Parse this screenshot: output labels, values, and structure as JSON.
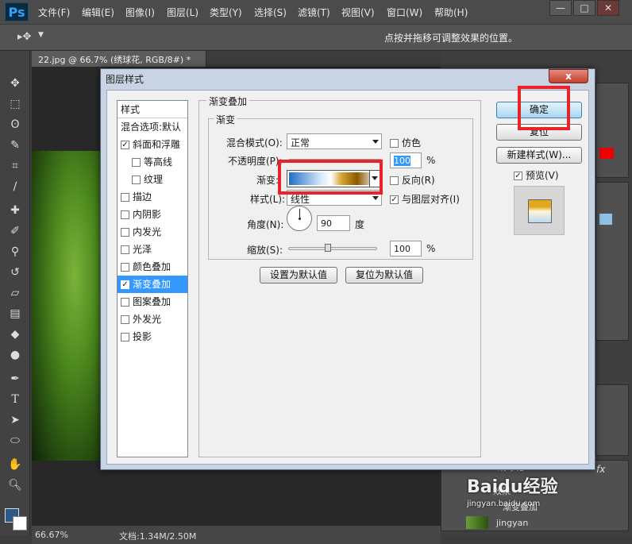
{
  "app": {
    "logo": "Ps"
  },
  "menu": [
    "文件(F)",
    "编辑(E)",
    "图像(I)",
    "图层(L)",
    "类型(Y)",
    "选择(S)",
    "滤镜(T)",
    "视图(V)",
    "窗口(W)",
    "帮助(H)"
  ],
  "window_controls": {
    "minimize": "—",
    "maximize": "□",
    "close": "✕"
  },
  "options_bar": {
    "hint": "点按并拖移可调整效果的位置。",
    "tool_glyph": "▸✥"
  },
  "document_tab": {
    "title": "22.jpg @ 66.7% (绣球花, RGB/8#) *",
    "close": "×"
  },
  "status": {
    "zoom": "66.67%",
    "doc_info": "文档:1.34M/2.50M"
  },
  "dialog": {
    "title": "图层样式",
    "close": "x",
    "styles_header": "样式",
    "styles": [
      {
        "label": "混合选项:默认",
        "checkbox": false,
        "checked": false
      },
      {
        "label": "斜面和浮雕",
        "checkbox": true,
        "checked": true
      },
      {
        "label": "等高线",
        "checkbox": true,
        "checked": false,
        "indent": true
      },
      {
        "label": "纹理",
        "checkbox": true,
        "checked": false,
        "indent": true
      },
      {
        "label": "描边",
        "checkbox": true,
        "checked": false
      },
      {
        "label": "内阴影",
        "checkbox": true,
        "checked": false
      },
      {
        "label": "内发光",
        "checkbox": true,
        "checked": false
      },
      {
        "label": "光泽",
        "checkbox": true,
        "checked": false
      },
      {
        "label": "颜色叠加",
        "checkbox": true,
        "checked": false
      },
      {
        "label": "渐变叠加",
        "checkbox": true,
        "checked": true,
        "selected": true
      },
      {
        "label": "图案叠加",
        "checkbox": true,
        "checked": false
      },
      {
        "label": "外发光",
        "checkbox": true,
        "checked": false
      },
      {
        "label": "投影",
        "checkbox": true,
        "checked": false
      }
    ],
    "section_title": "渐变叠加",
    "subsection_title": "渐变",
    "blend_mode": {
      "label": "混合模式(O):",
      "value": "正常"
    },
    "dither": {
      "label": "仿色",
      "checked": false
    },
    "opacity": {
      "label": "不透明度(P):",
      "value": "100",
      "unit": "%",
      "level": 1.0
    },
    "gradient": {
      "label": "渐变:",
      "stops": [
        "#1f6fc8",
        "#cfe4f6",
        "#ffffff",
        "#d4a634",
        "#8a5a00",
        "#ffffff"
      ]
    },
    "reverse": {
      "label": "反向(R)",
      "checked": false
    },
    "style": {
      "label": "样式(L):",
      "value": "线性"
    },
    "align": {
      "label": "与图层对齐(I)",
      "checked": true
    },
    "angle": {
      "label": "角度(N):",
      "value": "90",
      "unit": "度"
    },
    "scale": {
      "label": "缩放(S):",
      "value": "100",
      "unit": "%",
      "level": 0.45
    },
    "btn_make_default": "设置为默认值",
    "btn_reset_default": "复位为默认值",
    "btn_ok": "确定",
    "btn_reset": "复位",
    "btn_new_style": "新建样式(W)...",
    "preview": {
      "label": "预览(V)",
      "checked": true
    },
    "preview_colors": [
      "#e0a81c",
      "#fff6d8",
      "#bcd9f2"
    ]
  },
  "layers": {
    "layer_name": "绣球花",
    "effects_label": "效果",
    "gradient_effect": "渐变叠加",
    "bottom_layer": "jingyan",
    "fx": "fx"
  },
  "watermark": {
    "brand": "Baidu经验",
    "url": "jingyan.baidu.com"
  }
}
